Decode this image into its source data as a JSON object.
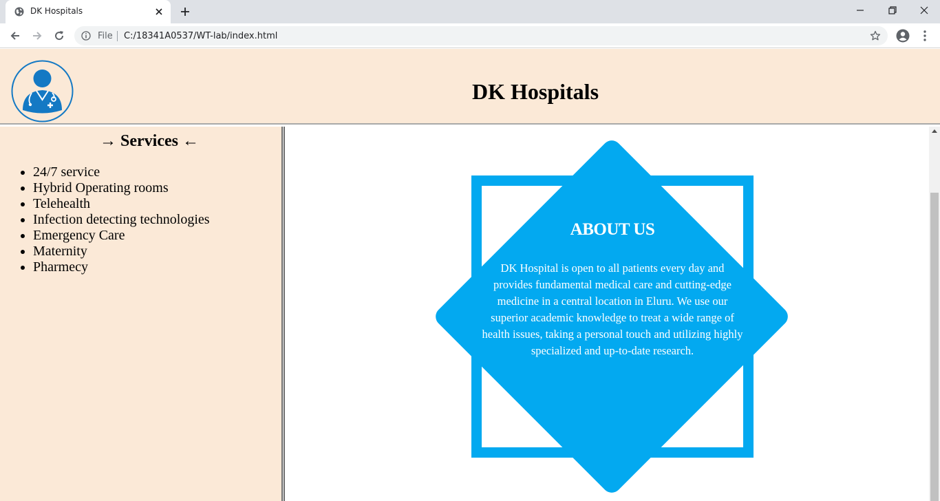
{
  "browser": {
    "tab_title": "DK Hospitals",
    "file_label": "File",
    "url": "C:/18341A0537/WT-lab/index.html",
    "icons": [
      "globe-icon",
      "close-icon",
      "plus-icon",
      "minimize-icon",
      "restore-icon",
      "window-close-icon",
      "back-icon",
      "forward-icon",
      "reload-icon",
      "info-icon",
      "star-icon",
      "profile-icon",
      "menu-icon"
    ]
  },
  "header": {
    "title": "DK Hospitals",
    "logo_icon": "doctor-icon"
  },
  "sidebar": {
    "heading": "→ Services ←",
    "items": [
      "24/7 service",
      "Hybrid Operating rooms",
      "Telehealth",
      "Infection detecting technologies",
      "Emergency Care",
      "Maternity",
      "Pharmecy"
    ]
  },
  "about": {
    "title": "ABOUT US",
    "text": "DK Hospital is open to all patients every day and provides fundamental medical care and cutting-edge medicine in a central location in Eluru. We use our superior academic knowledge to treat a wide range of health issues, taking a personal touch and utilizing highly specialized and up-to-date research."
  },
  "colors": {
    "header_bg": "#fbe9d7",
    "accent": "#03a9f0",
    "logo": "#1479c4"
  }
}
